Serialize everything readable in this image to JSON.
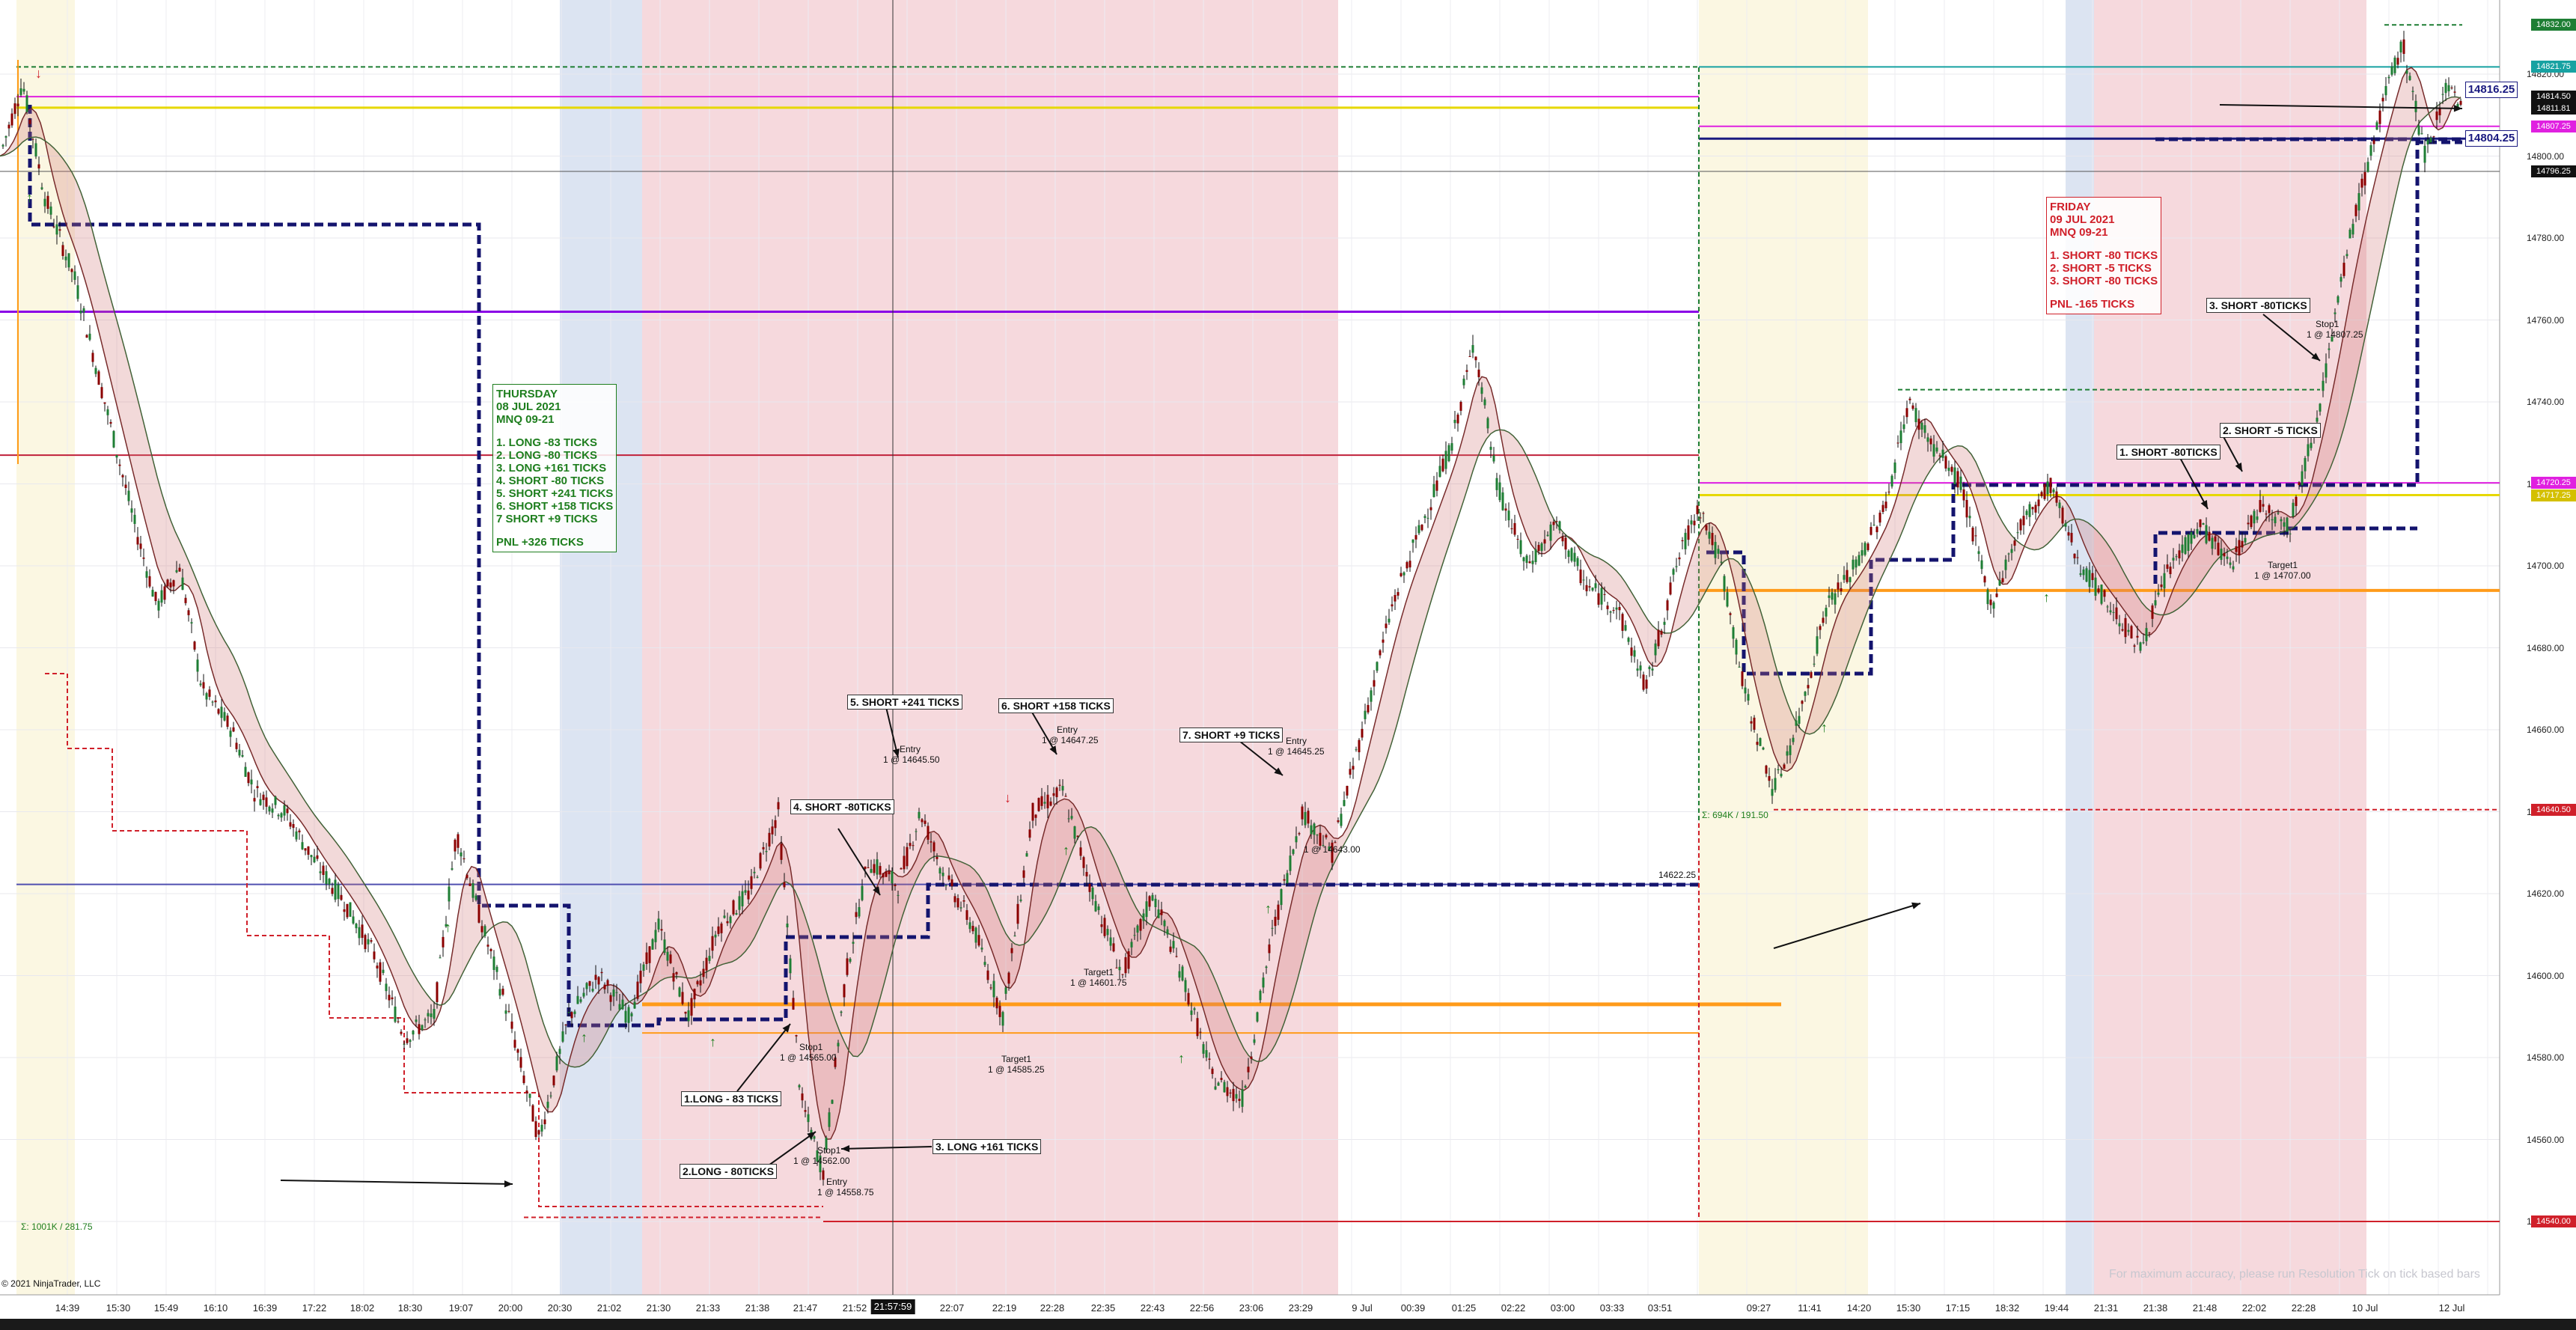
{
  "chart_data": {
    "type": "candlestick",
    "symbol": "MNQ 09-21",
    "y_ticks": [
      14540,
      14560,
      14580,
      14600,
      14620,
      14640,
      14660,
      14680,
      14700,
      14720,
      14740,
      14760,
      14780,
      14800,
      14820
    ],
    "y_tick_labels": [
      "14540.00",
      "14560.00",
      "14580.00",
      "14600.00",
      "14620.00",
      "14640.00",
      "14660.00",
      "14680.00",
      "14700.00",
      "14720.00",
      "14740.00",
      "14760.00",
      "14780.00",
      "14800.00",
      "14820.00"
    ],
    "x_tick_labels": [
      "14:39",
      "15:30",
      "15:49",
      "16:10",
      "16:39",
      "17:22",
      "18:02",
      "18:30",
      "19:07",
      "20:00",
      "20:30",
      "21:02",
      "21:30",
      "21:33",
      "21:38",
      "21:47",
      "21:52",
      "22:07",
      "22:19",
      "22:28",
      "22:35",
      "22:43",
      "22:56",
      "23:06",
      "23:29",
      "9 Jul",
      "00:39",
      "01:25",
      "02:22",
      "03:00",
      "03:33",
      "03:51",
      "09:27",
      "11:41",
      "14:20",
      "15:30",
      "17:15",
      "18:32",
      "19:44",
      "21:31",
      "21:38",
      "21:48",
      "22:02",
      "22:28",
      "10 Jul",
      "12 Jul"
    ],
    "cursor_time": "21:57:59",
    "price_markers": [
      {
        "label": "14832.00",
        "color": "#1e7e34"
      },
      {
        "label": "14821.75",
        "color": "#17a2a2"
      },
      {
        "label": "14816.25",
        "color": "#1a1a80",
        "boxed": true
      },
      {
        "label": "14814.50",
        "color": "#111111"
      },
      {
        "label": "14811.81",
        "color": "#111111"
      },
      {
        "label": "14807.25",
        "color": "#e020e0"
      },
      {
        "label": "14804.25",
        "color": "#1a1a80",
        "boxed": true
      },
      {
        "label": "14796.25",
        "color": "#111111"
      },
      {
        "label": "14720.25",
        "color": "#e020e0"
      },
      {
        "label": "14717.25",
        "color": "#d4c000"
      },
      {
        "label": "14640.50",
        "color": "#d0202a"
      },
      {
        "label": "14540.00",
        "color": "#d0202a"
      }
    ],
    "annotations": [
      {
        "label": "1.LONG - 83 TICKS"
      },
      {
        "label": "2.LONG - 80TICKS"
      },
      {
        "label": "3. LONG +161 TICKS"
      },
      {
        "label": "4. SHORT -80TICKS"
      },
      {
        "label": "5. SHORT +241 TICKS"
      },
      {
        "label": "6. SHORT +158 TICKS"
      },
      {
        "label": "7. SHORT +9 TICKS"
      },
      {
        "label": "1. SHORT -80TICKS"
      },
      {
        "label": "2. SHORT -5 TICKS"
      },
      {
        "label": "3. SHORT -80TICKS"
      }
    ],
    "order_labels": [
      {
        "text": "Entry"
      },
      {
        "text": "1 @ 14645.50"
      },
      {
        "text": "Entry"
      },
      {
        "text": "1 @ 14647.25"
      },
      {
        "text": "Entry"
      },
      {
        "text": "1 @ 14645.25"
      },
      {
        "text": "Target1"
      },
      {
        "text": "1 @ 14585.25"
      },
      {
        "text": "Target1"
      },
      {
        "text": "1 @ 14601.75"
      },
      {
        "text": "Stop1"
      },
      {
        "text": "1 @ 14565.00"
      },
      {
        "text": "Stop1"
      },
      {
        "text": "1 @ 14562.00"
      },
      {
        "text": "Entry"
      },
      {
        "text": "1 @ 14558.75"
      },
      {
        "text": "Target1"
      },
      {
        "text": "1 @ 14707.00"
      },
      {
        "text": "1 @ 14643.00"
      },
      {
        "text": "Stop1"
      },
      {
        "text": "1 @ 14807.25"
      },
      {
        "text": "14622.25"
      },
      {
        "text": "Σ: 694K / 191.50"
      },
      {
        "text": "Σ: 1001K / 281.75"
      }
    ]
  },
  "thursday_summary": {
    "lines": [
      "THURSDAY",
      "08 JUL 2021",
      "MNQ 09-21",
      "",
      "1. LONG -83 TICKS",
      "2. LONG -80 TICKS",
      "3. LONG +161 TICKS",
      "4. SHORT -80 TICKS",
      "5. SHORT +241 TICKS",
      "6. SHORT +158 TICKS",
      "7 SHORT +9 TICKS",
      "",
      "PNL +326  TICKS"
    ],
    "color": "#1e7e1e"
  },
  "friday_summary": {
    "lines": [
      "FRIDAY",
      "09 JUL 2021",
      "MNQ 09-21",
      "",
      "1. SHORT -80 TICKS",
      "2. SHORT -5 TICKS",
      "3. SHORT -80 TICKS",
      "",
      "PNL -165  TICKS"
    ],
    "color": "#d0202a"
  },
  "copyright": "© 2021 NinjaTrader, LLC",
  "footer_hint": "For maximum accuracy, please run Resolution Tick on tick based bars",
  "colors": {
    "up_candle": "#1e7e34",
    "down_candle": "#8b0000",
    "session_red": "#f6d9dd",
    "session_blue": "#dce4f2",
    "session_yellow": "#fbf7e2",
    "navy_dashed": "#14146e",
    "orange": "#ff9b1a",
    "magenta": "#e020e0",
    "yellow": "#e6d800",
    "purple": "#8a00e6"
  }
}
